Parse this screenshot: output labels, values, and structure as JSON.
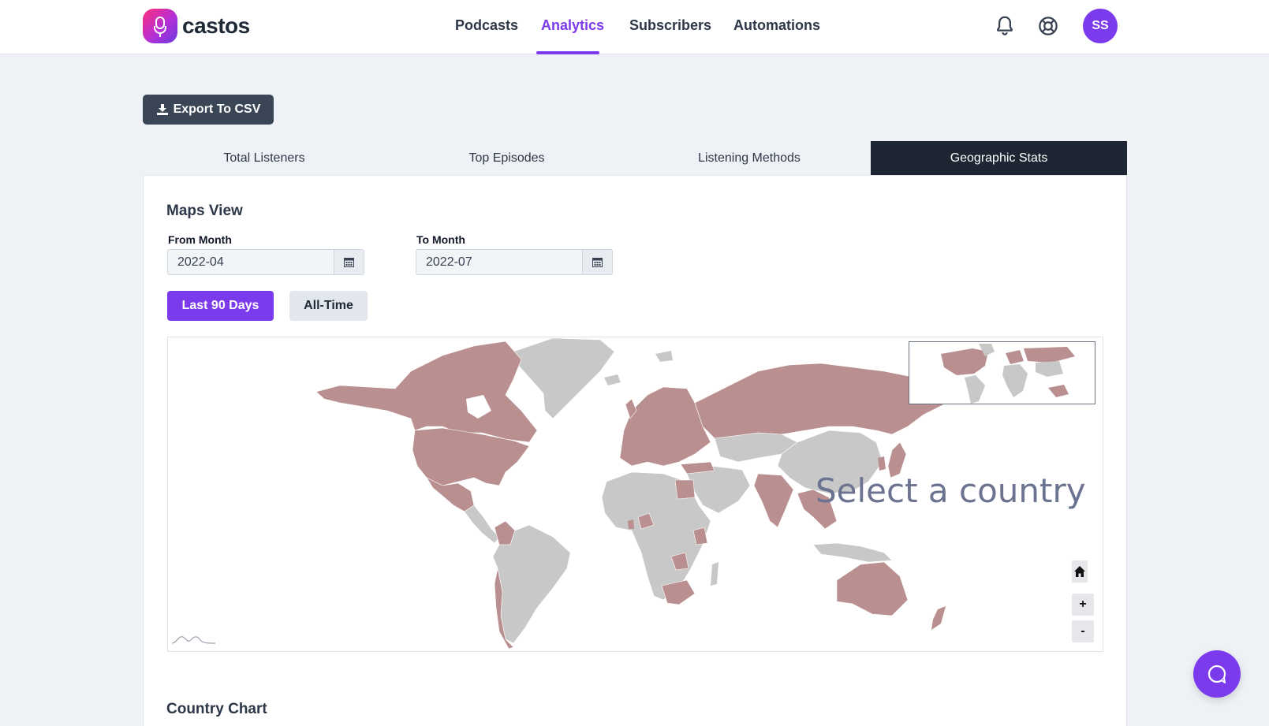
{
  "brand": {
    "name": "castos"
  },
  "nav": {
    "items": [
      {
        "label": "Podcasts",
        "active": false
      },
      {
        "label": "Analytics",
        "active": true
      },
      {
        "label": "Subscribers",
        "active": false
      },
      {
        "label": "Automations",
        "active": false
      }
    ],
    "icons": [
      "bell-icon",
      "help-lifebuoy-icon"
    ],
    "avatar_initials": "SS"
  },
  "toolbar": {
    "export_label": "Export To CSV"
  },
  "tabs": [
    {
      "label": "Total Listeners",
      "active": false
    },
    {
      "label": "Top Episodes",
      "active": false
    },
    {
      "label": "Listening Methods",
      "active": false
    },
    {
      "label": "Geographic Stats",
      "active": true
    }
  ],
  "maps_view": {
    "title": "Maps View",
    "from_label": "From Month",
    "from_value": "2022-04",
    "to_label": "To Month",
    "to_value": "2022-07",
    "last90_label": "Last 90 Days",
    "alltime_label": "All-Time",
    "map_prompt": "Select a country",
    "zoom_in_label": "+",
    "zoom_out_label": "-"
  },
  "country_chart": {
    "title": "Country Chart"
  },
  "colors": {
    "accent": "#7c3aed",
    "highlight_country": "#b98f90",
    "inactive_country": "#c8c8c8",
    "dark_tab": "#1e2633"
  }
}
